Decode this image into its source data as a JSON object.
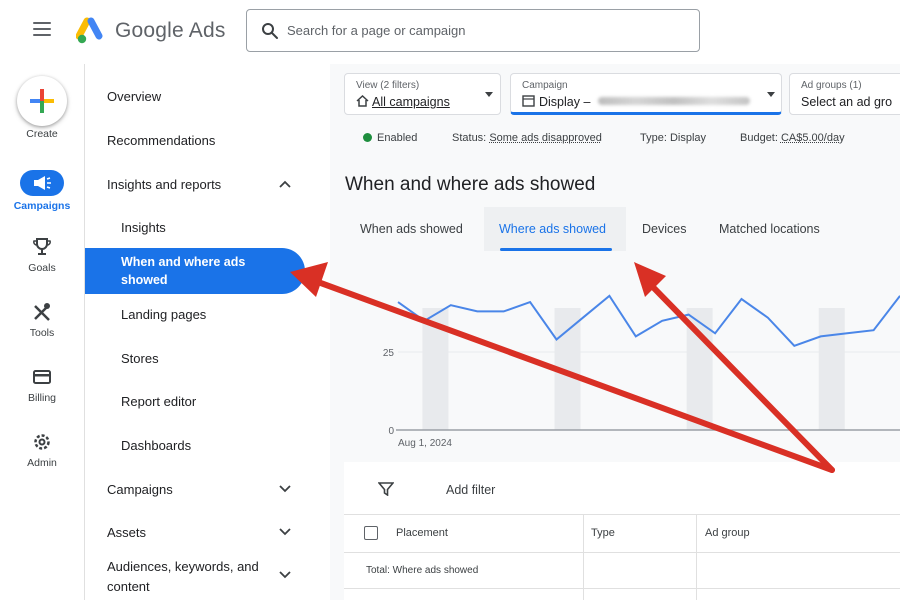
{
  "header": {
    "brand": "Google Ads",
    "search_placeholder": "Search for a page or campaign"
  },
  "rail": {
    "create": "Create",
    "campaigns": "Campaigns",
    "goals": "Goals",
    "tools": "Tools",
    "billing": "Billing",
    "admin": "Admin"
  },
  "sidebar": {
    "overview": "Overview",
    "recommendations": "Recommendations",
    "insights_reports": "Insights and reports",
    "insights": "Insights",
    "when_where": "When and where ads showed",
    "landing_pages": "Landing pages",
    "stores": "Stores",
    "report_editor": "Report editor",
    "dashboards": "Dashboards",
    "campaigns": "Campaigns",
    "assets": "Assets",
    "audiences_line1": "Audiences, keywords, and",
    "audiences_line2": "content"
  },
  "filters": {
    "view_label": "View (2 filters)",
    "view_value": "All campaigns",
    "campaign_label": "Campaign",
    "campaign_value": "Display –",
    "adgroups_label": "Ad groups (1)",
    "adgroups_value": "Select an ad gro"
  },
  "status": {
    "enabled": "Enabled",
    "status_label": "Status:",
    "status_value": "Some ads disapproved",
    "type_label": "Type:",
    "type_value": "Display",
    "budget_label": "Budget:",
    "budget_value": "CA$5.00/day"
  },
  "page": {
    "title": "When and where ads showed",
    "tabs": [
      "When ads showed",
      "Where ads showed",
      "Devices",
      "Matched locations"
    ]
  },
  "chart_data": {
    "type": "line",
    "x_start_label": "Aug 1, 2024",
    "y_ticks": [
      "0",
      "25"
    ],
    "ylim": [
      0,
      50
    ],
    "values": [
      41,
      35,
      40,
      38,
      38,
      41,
      29,
      36,
      43,
      30,
      35,
      37,
      31,
      42,
      36,
      27,
      30,
      31,
      32,
      43
    ],
    "shaded_bands": [
      1,
      6,
      11,
      16
    ],
    "colors": {
      "line": "#4a86e8",
      "band": "#e8eaed",
      "axis": "#9aa0a6"
    }
  },
  "table": {
    "add_filter": "Add filter",
    "headers": [
      "Placement",
      "Type",
      "Ad group"
    ],
    "total_row": "Total: Where ads showed"
  },
  "colors": {
    "accent": "#1a73e8",
    "annotation_arrow": "#d93025"
  }
}
